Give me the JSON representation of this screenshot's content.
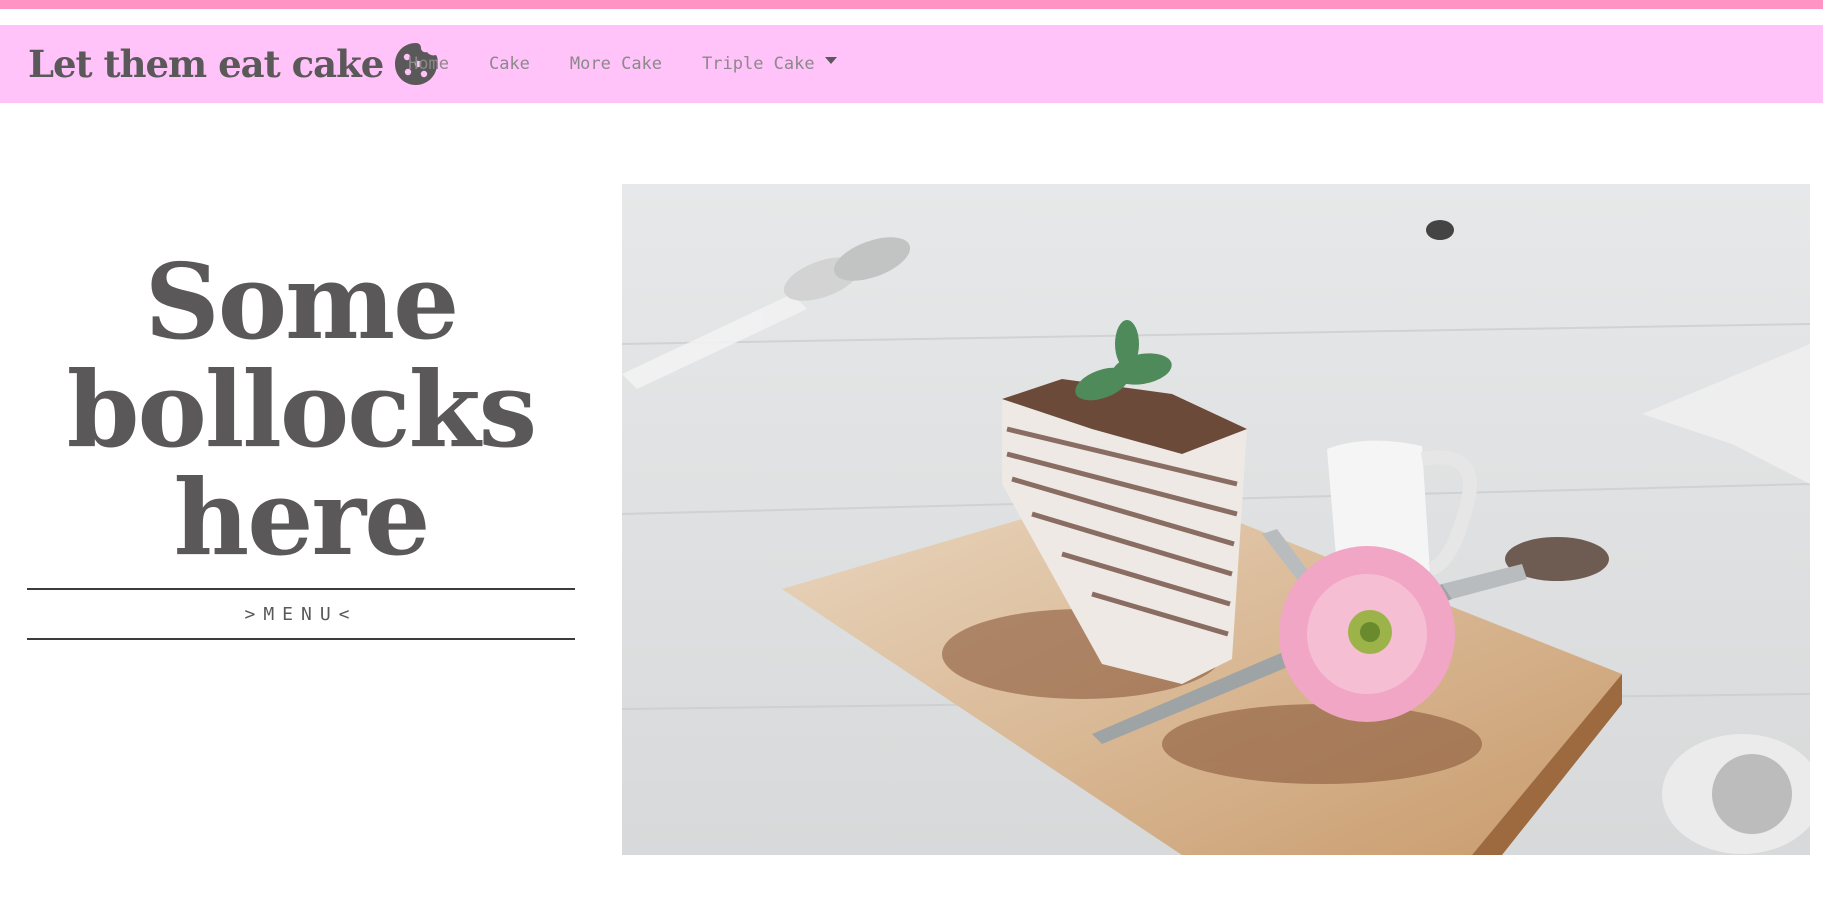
{
  "topbar": {
    "color": "#ff94c4"
  },
  "navbar": {
    "background": "#ffc3f9",
    "brand": "Let them eat cake",
    "brand_icon": "cookie-icon",
    "items": [
      {
        "label": "Home"
      },
      {
        "label": "Cake"
      },
      {
        "label": "More Cake"
      },
      {
        "label": "Triple Cake",
        "dropdown": true
      }
    ]
  },
  "hero": {
    "title_lines": [
      "Some",
      "bollocks",
      "here"
    ],
    "menu_label": ">MENU<"
  },
  "image": {
    "subject": "slice of crepe cake on a wooden board with fork, pink flower and milk jug"
  }
}
